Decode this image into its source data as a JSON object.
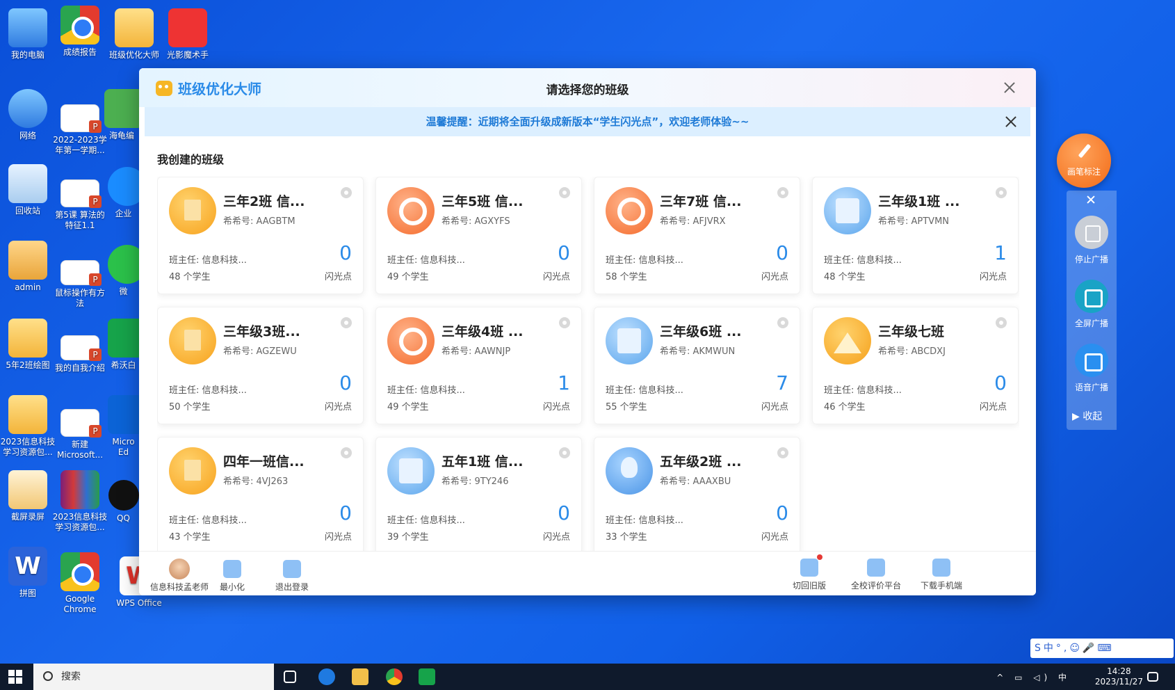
{
  "desktop": {
    "icons": [
      {
        "label": "我的电脑"
      },
      {
        "label": "成绩报告"
      },
      {
        "label": "班级优化大师"
      },
      {
        "label": "光影魔术手"
      },
      {
        "label": "网络"
      },
      {
        "label": "2022-2023学年第一学期..."
      },
      {
        "label": "海龟编"
      },
      {
        "label": "回收站"
      },
      {
        "label": "第5课 算法的特征1.1"
      },
      {
        "label": "企业"
      },
      {
        "label": "admin"
      },
      {
        "label": "鼠标操作有方法"
      },
      {
        "label": "微"
      },
      {
        "label": "5年2班绘图"
      },
      {
        "label": "我的自我介绍"
      },
      {
        "label": "希沃白"
      },
      {
        "label": "2023信息科技学习资源包..."
      },
      {
        "label": "新建 Microsoft..."
      },
      {
        "label": "Micro Ed"
      },
      {
        "label": "截屏录屏"
      },
      {
        "label": "2023信息科技学习资源包..."
      },
      {
        "label": "QQ"
      },
      {
        "label": "拼图"
      },
      {
        "label": "Google Chrome"
      },
      {
        "label": "WPS Office"
      }
    ]
  },
  "dialog": {
    "brand": "班级优化大师",
    "title": "请选择您的班级",
    "notice": "温馨提醒：近期将全面升级成新版本“学生闪光点”，欢迎老师体验~~",
    "section_title": "我创建的班级",
    "classes": [
      {
        "name": "三年2班 信...",
        "code": "希希号: AAGBTM",
        "teacher": "班主任: 信息科技...",
        "students": "48 个学生",
        "points": "0",
        "unit": "闪光点",
        "icon": "book-icon"
      },
      {
        "name": "三年5班 信...",
        "code": "希希号: AGXYFS",
        "teacher": "班主任: 信息科技...",
        "students": "49 个学生",
        "points": "0",
        "unit": "闪光点",
        "icon": "search-icon"
      },
      {
        "name": "三年7班 信...",
        "code": "希希号: AFJVRX",
        "teacher": "班主任: 信息科技...",
        "students": "58 个学生",
        "points": "0",
        "unit": "闪光点",
        "icon": "search-icon"
      },
      {
        "name": "三年级1班 ...",
        "code": "希希号: APTVMN",
        "teacher": "班主任: 信息科技...",
        "students": "48 个学生",
        "points": "1",
        "unit": "闪光点",
        "icon": "calculator-icon"
      },
      {
        "name": "三年级3班...",
        "code": "希希号: AGZEWU",
        "teacher": "班主任: 信息科技...",
        "students": "50 个学生",
        "points": "0",
        "unit": "闪光点",
        "icon": "book-icon"
      },
      {
        "name": "三年级4班 ...",
        "code": "希希号: AAWNJP",
        "teacher": "班主任: 信息科技...",
        "students": "49 个学生",
        "points": "1",
        "unit": "闪光点",
        "icon": "search-icon"
      },
      {
        "name": "三年级6班 ...",
        "code": "希希号: AKMWUN",
        "teacher": "班主任: 信息科技...",
        "students": "55 个学生",
        "points": "7",
        "unit": "闪光点",
        "icon": "calculator-icon"
      },
      {
        "name": "三年级七班",
        "code": "希希号: ABCDXJ",
        "teacher": "班主任: 信息科技...",
        "students": "46 个学生",
        "points": "0",
        "unit": "闪光点",
        "icon": "ruler-icon"
      },
      {
        "name": "四年一班信...",
        "code": "希希号: 4VJ263",
        "teacher": "班主任: 信息科技...",
        "students": "43 个学生",
        "points": "0",
        "unit": "闪光点",
        "icon": "book-icon"
      },
      {
        "name": "五年1班 信...",
        "code": "希希号: 9TY246",
        "teacher": "班主任: 信息科技...",
        "students": "39 个学生",
        "points": "0",
        "unit": "闪光点",
        "icon": "calculator-icon"
      },
      {
        "name": "五年级2班 ...",
        "code": "希希号: AAAXBU",
        "teacher": "班主任: 信息科技...",
        "students": "33 个学生",
        "points": "0",
        "unit": "闪光点",
        "icon": "lightbulb-icon"
      }
    ],
    "footer": {
      "user": "信息科技孟老师",
      "minimize": "最小化",
      "logout": "退出登录",
      "switch_old": "切回旧版",
      "school_platform": "全校评价平台",
      "download_app": "下载手机端"
    }
  },
  "side_toolbar": {
    "brush": "画笔标注",
    "stop_broadcast": "停止广播",
    "fullscreen_broadcast": "全屏广播",
    "voice_broadcast": "语音广播",
    "collapse": "▶  收起"
  },
  "taskbar": {
    "search_placeholder": "搜索",
    "ime_lang": "中",
    "time": "14:28",
    "date": "2023/11/27",
    "ime_bar": "S中°,☺🎤⌨"
  }
}
